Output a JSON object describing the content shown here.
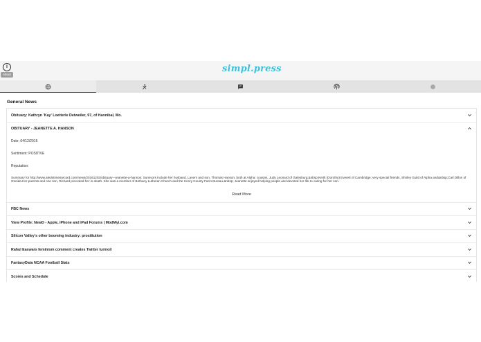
{
  "header": {
    "about_tooltip": "About",
    "info_icon": "info-icon",
    "logo": "simpl.press",
    "logo_color": "#3fc2d9"
  },
  "tabs": [
    {
      "icon": "globe-icon",
      "active": true
    },
    {
      "icon": "running-person-icon",
      "active": false
    },
    {
      "icon": "chat-icon",
      "active": false
    },
    {
      "icon": "broadcast-icon",
      "active": false
    },
    {
      "icon": "circle-icon",
      "active": false
    }
  ],
  "section_title": "General News",
  "items": [
    {
      "title": "Obituary: Kathryn 'Kay' Loetterle Detweiler, 97, of Hannibal, Mo."
    },
    {
      "title": "OBITUARY - JEANETTE A. HANSON",
      "expanded": true,
      "date": "Date: 04/12/2016",
      "sentiment": "Sentiment: POSITIVE",
      "reputation": "Reputation:",
      "summary": "Summary for http://www.aledotimesrecord.com/news/20161202/obituary---jeanette-a-hanson: Survivors include her husband, Lavern and son, Thomas Hanson, both at Alpha; cousins, Judy Leonard of Galesburg;&nbsp;Keith (Dorothy) Everett of Cambridge; very special friends, Shirley Guild of Alpha and&nbsp;Carl Dillon of Oneida.Her parents and one son, Richard preceded her in death. She was a member of Bethany Lutheran Church and the Henry County Farm Bureau.&nbsp; Jeanette enjoyed helping people and devoted her life to caring for her son.",
      "read_more": "Read More"
    },
    {
      "title": "FBC News"
    },
    {
      "title": "View Profile: NewD - Apple, iPhone and iPad Forums | ModMyi.com"
    },
    {
      "title": "Silicon Valley's other booming industry: prostitution"
    },
    {
      "title": "Rahul Easwars feminism comment creates Twitter turmoil"
    },
    {
      "title": "FantasyData NCAA Football Stats"
    },
    {
      "title": "Scores and Schedule"
    }
  ]
}
